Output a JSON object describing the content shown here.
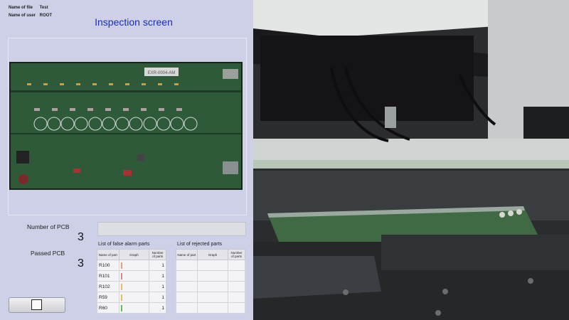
{
  "meta": {
    "file_label": "Name of file",
    "file_value": "Test",
    "user_label": "Name of user",
    "user_value": "ROOT"
  },
  "title": "Inspection screen",
  "board_label": "EXR-0004-AM",
  "stats": {
    "pcb_label": "Number of PCB",
    "pcb_value": "3",
    "passed_label": "Passed PCB",
    "passed_value": "3"
  },
  "false_alarm": {
    "title": "List of false alarm parts",
    "headers": [
      "Name of part",
      "Graph",
      "Number of parts"
    ],
    "rows": [
      {
        "name": "R100",
        "count": "1",
        "color": "#e0a080"
      },
      {
        "name": "R101",
        "count": "1",
        "color": "#d08a8a"
      },
      {
        "name": "R102",
        "count": "1",
        "color": "#e6c060"
      },
      {
        "name": "R59",
        "count": "1",
        "color": "#e6c060"
      },
      {
        "name": "R60",
        "count": "1",
        "color": "#60c060"
      }
    ]
  },
  "rejected": {
    "title": "List of rejected parts",
    "headers": [
      "Name of part",
      "Graph",
      "Number of parts"
    ]
  },
  "colors": {
    "panel": "#cdd0e6",
    "title": "#1b2fb8",
    "pcb_green": "#2f5a3a"
  }
}
